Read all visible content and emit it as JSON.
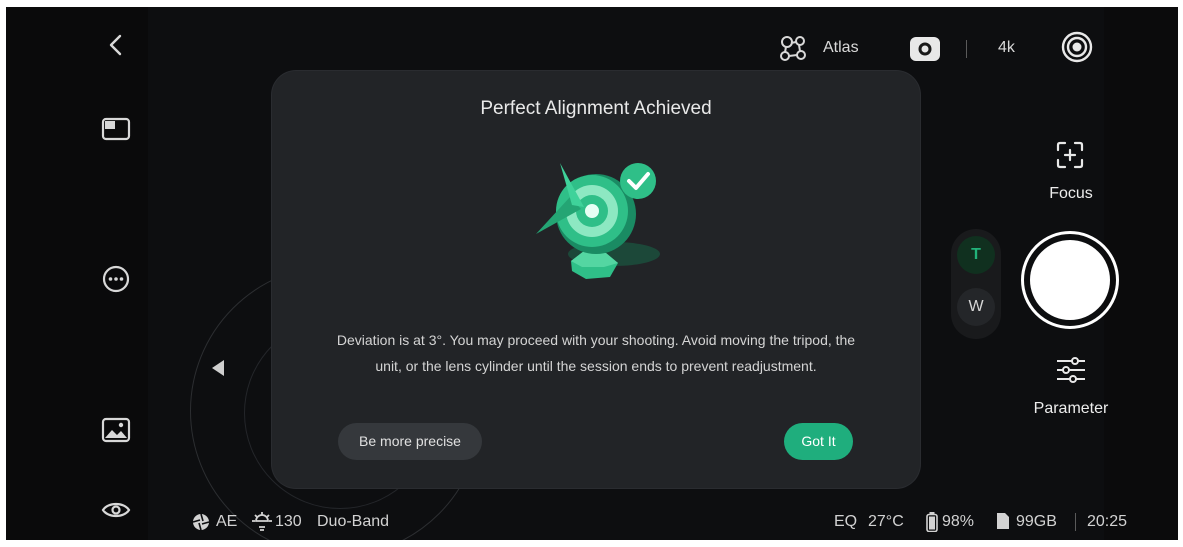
{
  "topbar": {
    "atlas_label": "Atlas",
    "resolution": "4k",
    "icons": [
      "network-icon",
      "camera-mode-icon",
      "record-target-icon"
    ]
  },
  "left_rail": {
    "icons": [
      "back-icon",
      "layout-icon",
      "more-icon",
      "gallery-icon",
      "eye-icon"
    ]
  },
  "modal": {
    "title": "Perfect Alignment Achieved",
    "body": "Deviation is at 3°. You may proceed with your shooting. Avoid moving the tripod, the unit, or the lens cylinder until the session ends to prevent readjustment.",
    "secondary_button": "Be more precise",
    "primary_button": "Got It",
    "accent_color": "#1fae7d"
  },
  "zoom": {
    "tele_label": "T",
    "wide_label": "W"
  },
  "right_panel": {
    "focus_label": "Focus",
    "parameter_label": "Parameter"
  },
  "status_bar": {
    "ae": "AE",
    "brightness": "130",
    "band": "Duo-Band",
    "eq": "EQ",
    "temperature": "27°C",
    "battery": "98%",
    "storage": "99GB",
    "time": "20:25"
  }
}
